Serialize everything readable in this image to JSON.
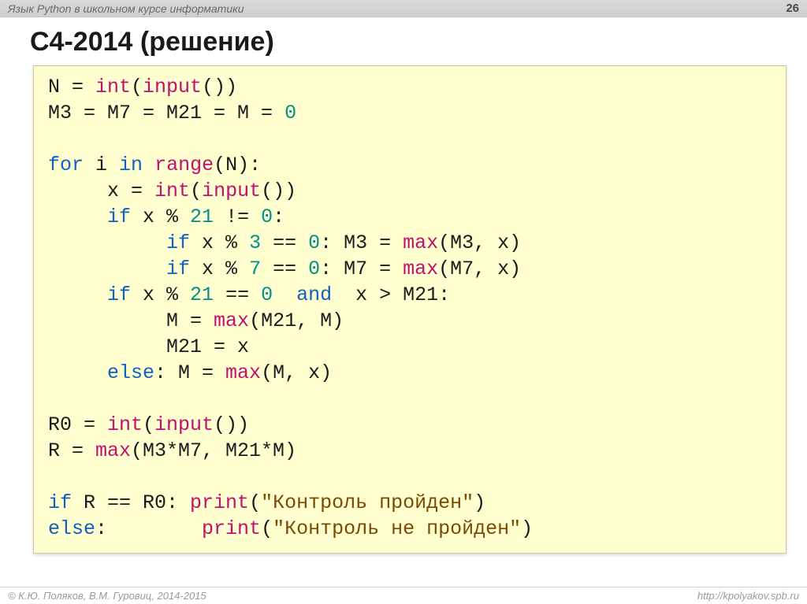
{
  "header": {
    "lecture": "Язык Python в школьном курсе информатики",
    "page": "26"
  },
  "title": "C4-2014 (решение)",
  "code": {
    "l1a": "N = ",
    "l1_int": "int",
    "l1b": "(",
    "l1_inp": "input",
    "l1c": "())",
    "l2a": "M3 = M7 = M21 = M = ",
    "l2_0": "0",
    "l3_for": "for",
    "l3a": " i ",
    "l3_in": "in",
    "l3b": " ",
    "l3_rng": "range",
    "l3c": "(N):",
    "l4a": "     x = ",
    "l4_int": "int",
    "l4b": "(",
    "l4_inp": "input",
    "l4c": "())",
    "l5a": "     ",
    "l5_if": "if",
    "l5b": " x % ",
    "l5_21": "21",
    "l5c": " != ",
    "l5_0": "0",
    "l5d": ":",
    "l6a": "          ",
    "l6_if": "if",
    "l6b": " x % ",
    "l6_3": "3",
    "l6c": " == ",
    "l6_0": "0",
    "l6d": ": M3 = ",
    "l6_max": "max",
    "l6e": "(M3, x)",
    "l7a": "          ",
    "l7_if": "if",
    "l7b": " x % ",
    "l7_7": "7",
    "l7c": " == ",
    "l7_0": "0",
    "l7d": ": M7 = ",
    "l7_max": "max",
    "l7e": "(M7, x)",
    "l8a": "     ",
    "l8_if": "if",
    "l8b": " x % ",
    "l8_21": "21",
    "l8c": " == ",
    "l8_0": "0",
    "l8d": "  ",
    "l8_and": "and",
    "l8e": "  x > M21:",
    "l9a": "          M = ",
    "l9_max": "max",
    "l9b": "(M21, M)",
    "l10": "          M21 = x",
    "l11a": "     ",
    "l11_else": "else",
    "l11b": ": M = ",
    "l11_max": "max",
    "l11c": "(M, x)",
    "l12a": "R0 = ",
    "l12_int": "int",
    "l12b": "(",
    "l12_inp": "input",
    "l12c": "())",
    "l13a": "R = ",
    "l13_max": "max",
    "l13b": "(M3*M7, M21*M)",
    "l14_if": "if",
    "l14a": " R == R0: ",
    "l14_print": "print",
    "l14b": "(",
    "l14_str": "\"Контроль пройден\"",
    "l14c": ")",
    "l15_else": "else",
    "l15a": ":        ",
    "l15_print": "print",
    "l15b": "(",
    "l15_str": "\"Контроль не пройден\"",
    "l15c": ")"
  },
  "footer": {
    "left": "© К.Ю. Поляков, В.М. Гуровиц, 2014-2015",
    "right": "http://kpolyakov.spb.ru"
  }
}
